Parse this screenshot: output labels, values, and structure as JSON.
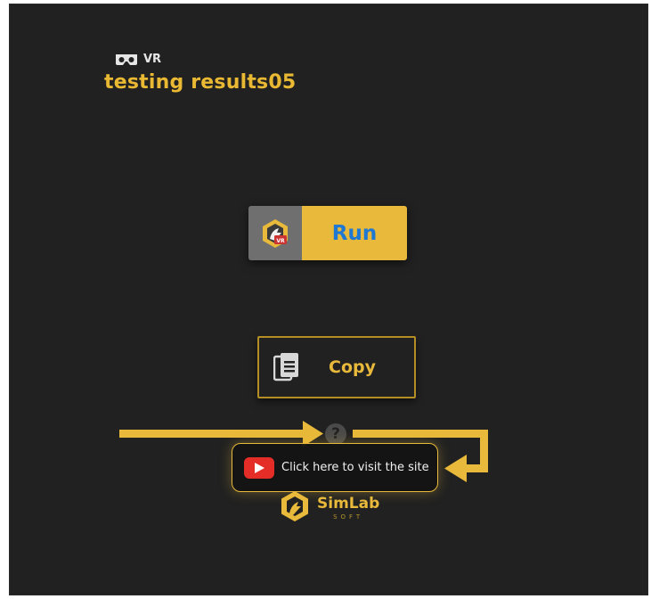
{
  "header": {
    "badge_label": "VR",
    "badge_icon": "vr-headset-icon",
    "title": "testing results05"
  },
  "actions": {
    "run_label": "Run",
    "run_icon": "app-logo-icon",
    "copy_label": "Copy",
    "copy_icon": "copy-document-icon"
  },
  "help": {
    "icon_glyph": "?",
    "link_label": "Click here to visit the site",
    "link_icon": "youtube-play-icon"
  },
  "brand": {
    "name": "SimLab",
    "sub": "SOFT",
    "icon": "simlab-logo-icon"
  },
  "colors": {
    "background": "#212121",
    "accent": "#e8b93a",
    "run_text": "#1f78d1",
    "youtube_red": "#e52d27"
  }
}
